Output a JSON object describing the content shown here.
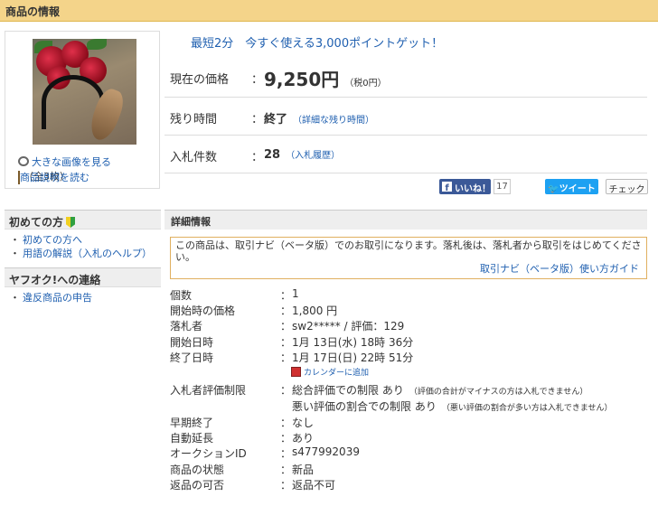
{
  "header": {
    "title": "商品の情報"
  },
  "image_panel": {
    "enlarge_link": "大きな画像を見る",
    "image_count": "（全3枚）",
    "description_link": "商品説明を読む"
  },
  "promo": "最短2分　今すぐ使える3,000ポイントゲット！",
  "price_row": {
    "label": "現在の価格",
    "colon": "：",
    "value": "9,250円",
    "tax_note": "（税0円）"
  },
  "time_row": {
    "label": "残り時間",
    "colon": "：",
    "value": "終了",
    "detail_link": "（詳細な残り時間）"
  },
  "bids_row": {
    "label": "入札件数",
    "colon": "：",
    "value": "28",
    "history_link": "（入札履歴）"
  },
  "social": {
    "facebook_label": "いいね！",
    "facebook_count": "17",
    "tweet_label": "ツイート",
    "check_label": "チェック"
  },
  "sidebar": {
    "beginner_title": "初めての方",
    "beginner_items": [
      "初めての方へ",
      "用語の解説（入札のヘルプ）"
    ],
    "contact_title": "ヤフオク!への連絡",
    "contact_items": [
      "違反商品の申告"
    ]
  },
  "details": {
    "title": "詳細情報",
    "notice_text": "この商品は、取引ナビ（ベータ版）でのお取引になります。落札後は、落札者から取引をはじめてください。",
    "notice_link": "取引ナビ（ベータ版）使い方ガイド",
    "rows": [
      {
        "key": "個数",
        "value": "1"
      },
      {
        "key": "開始時の価格",
        "value": "1,800 円"
      },
      {
        "key": "落札者",
        "value": "sw2***** / 評価：129"
      },
      {
        "key": "開始日時",
        "value": "1月 13日(水) 18時 36分"
      },
      {
        "key": "終了日時",
        "value": "1月 17日(日) 22時 51分"
      }
    ],
    "calendar_link": "カレンダーに追加",
    "restriction_key": "入札者評価制限",
    "restriction_1": "総合評価での制限 あり",
    "restriction_1_note": "（評価の合計がマイナスの方は入札できません）",
    "restriction_2": "悪い評価の割合での制限 あり",
    "restriction_2_note": "（悪い評価の割合が多い方は入札できません）",
    "rows2": [
      {
        "key": "早期終了",
        "value": "なし"
      },
      {
        "key": "自動延長",
        "value": "あり"
      },
      {
        "key": "オークションID",
        "value": "s477992039"
      },
      {
        "key": "商品の状態",
        "value": "新品"
      },
      {
        "key": "返品の可否",
        "value": "返品不可"
      }
    ],
    "colon": "："
  }
}
